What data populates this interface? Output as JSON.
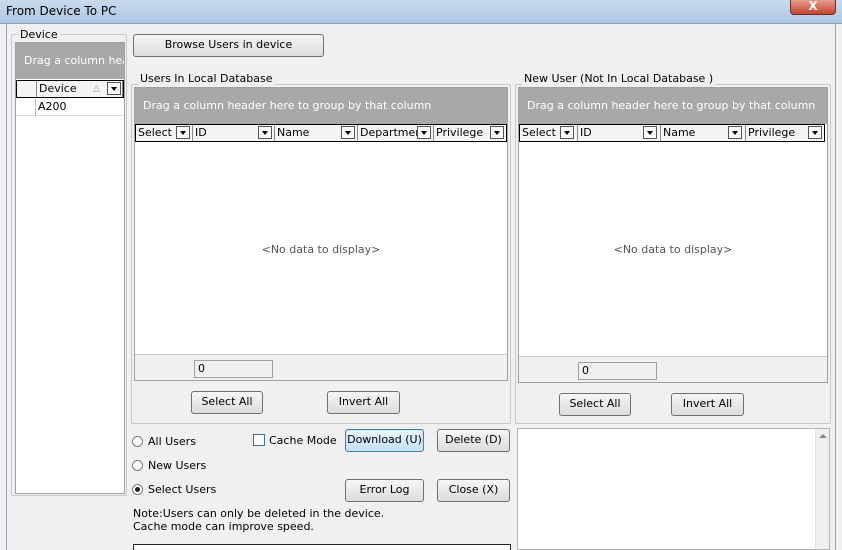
{
  "window": {
    "title": "From Device To PC",
    "close_label": "X"
  },
  "device_panel": {
    "legend": "Device",
    "group_hint": "Drag a column header here to group by that column",
    "column": "Device",
    "rows": [
      "A200"
    ]
  },
  "browse_button": "Browse Users in device",
  "local_db": {
    "legend": "Users In Local Database",
    "group_hint": "Drag a column header here to group by that column",
    "columns": [
      "Select",
      "ID",
      "Name",
      "Department",
      "Privilege"
    ],
    "no_data": "<No data to display>",
    "count": "0",
    "select_all": "Select All",
    "invert_all": "Invert All"
  },
  "new_user": {
    "legend": "New User (Not In Local Database )",
    "group_hint": "Drag a column header here to group by that column",
    "columns": [
      "Select",
      "ID",
      "Name",
      "Privilege"
    ],
    "no_data": "<No data to display>",
    "count": "0",
    "select_all": "Select All",
    "invert_all": "Invert All"
  },
  "options": {
    "all_users": "All Users",
    "new_users": "New Users",
    "select_users": "Select Users",
    "selected": "select_users",
    "cache_mode": "Cache Mode",
    "download": "Download (U)",
    "delete": "Delete (D)",
    "error_log": "Error Log",
    "close": "Close (X)",
    "note1": "Note:Users can only be deleted in the device.",
    "note2": "Cache mode can improve speed."
  }
}
